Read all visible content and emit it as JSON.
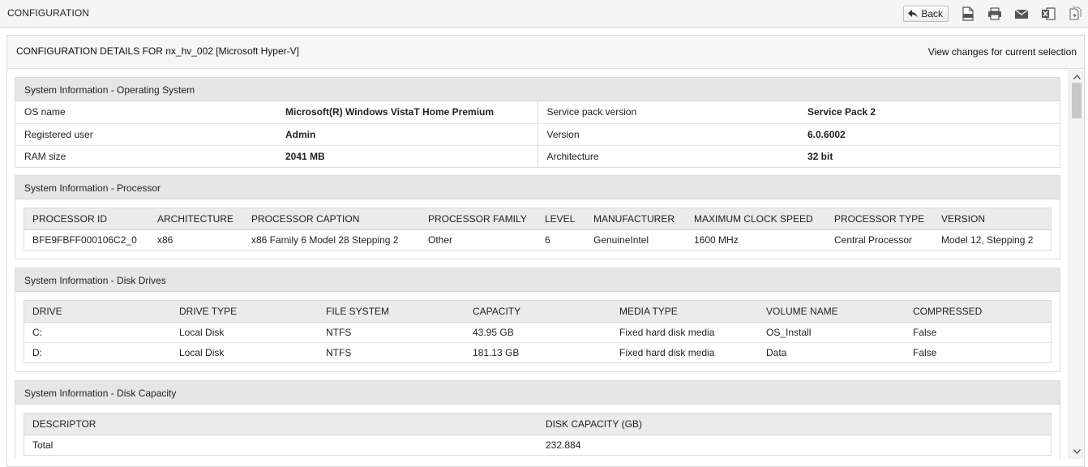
{
  "page": {
    "title": "CONFIGURATION"
  },
  "toolbar": {
    "back_label": "Back",
    "icons": [
      "pdf-icon",
      "print-icon",
      "email-icon",
      "excel-icon",
      "export-icon"
    ]
  },
  "panel": {
    "title": "CONFIGURATION DETAILS FOR nx_hv_002 [Microsoft Hyper-V]",
    "link": "View changes for current selection"
  },
  "os": {
    "heading": "System Information - Operating System",
    "rows": [
      {
        "k1": "OS name",
        "v1": "Microsoft(R) Windows VistaT Home Premium",
        "k2": "Service pack version",
        "v2": "Service Pack 2"
      },
      {
        "k1": "Registered user",
        "v1": "Admin",
        "k2": "Version",
        "v2": "6.0.6002"
      },
      {
        "k1": "RAM size",
        "v1": "2041 MB",
        "k2": "Architecture",
        "v2": "32 bit"
      }
    ]
  },
  "processor": {
    "heading": "System Information - Processor",
    "columns": [
      "PROCESSOR ID",
      "ARCHITECTURE",
      "PROCESSOR CAPTION",
      "PROCESSOR FAMILY",
      "LEVEL",
      "MANUFACTURER",
      "MAXIMUM CLOCK SPEED",
      "PROCESSOR TYPE",
      "VERSION"
    ],
    "rows": [
      [
        "BFE9FBFF000106C2_0",
        "x86",
        "x86 Family 6 Model 28 Stepping 2",
        "Other",
        "6",
        "GenuineIntel",
        "1600 MHz",
        "Central Processor",
        "Model 12, Stepping 2"
      ]
    ]
  },
  "disks": {
    "heading": "System Information - Disk Drives",
    "columns": [
      "DRIVE",
      "DRIVE TYPE",
      "FILE SYSTEM",
      "CAPACITY",
      "MEDIA TYPE",
      "VOLUME NAME",
      "COMPRESSED"
    ],
    "rows": [
      [
        "C:",
        "Local Disk",
        "NTFS",
        "43.95 GB",
        "Fixed hard disk media",
        "OS_Install",
        "False"
      ],
      [
        "D:",
        "Local Disk",
        "NTFS",
        "181.13 GB",
        "Fixed hard disk media",
        "Data",
        "False"
      ]
    ]
  },
  "capacity": {
    "heading": "System Information - Disk Capacity",
    "columns": [
      "DESCRIPTOR",
      "DISK CAPACITY (GB)"
    ],
    "rows": [
      [
        "Total",
        "232.884"
      ]
    ]
  },
  "colors": {
    "section_header": "#e6e6e6",
    "border": "#dcdcdc",
    "panel_header": "#f6f6f6"
  }
}
